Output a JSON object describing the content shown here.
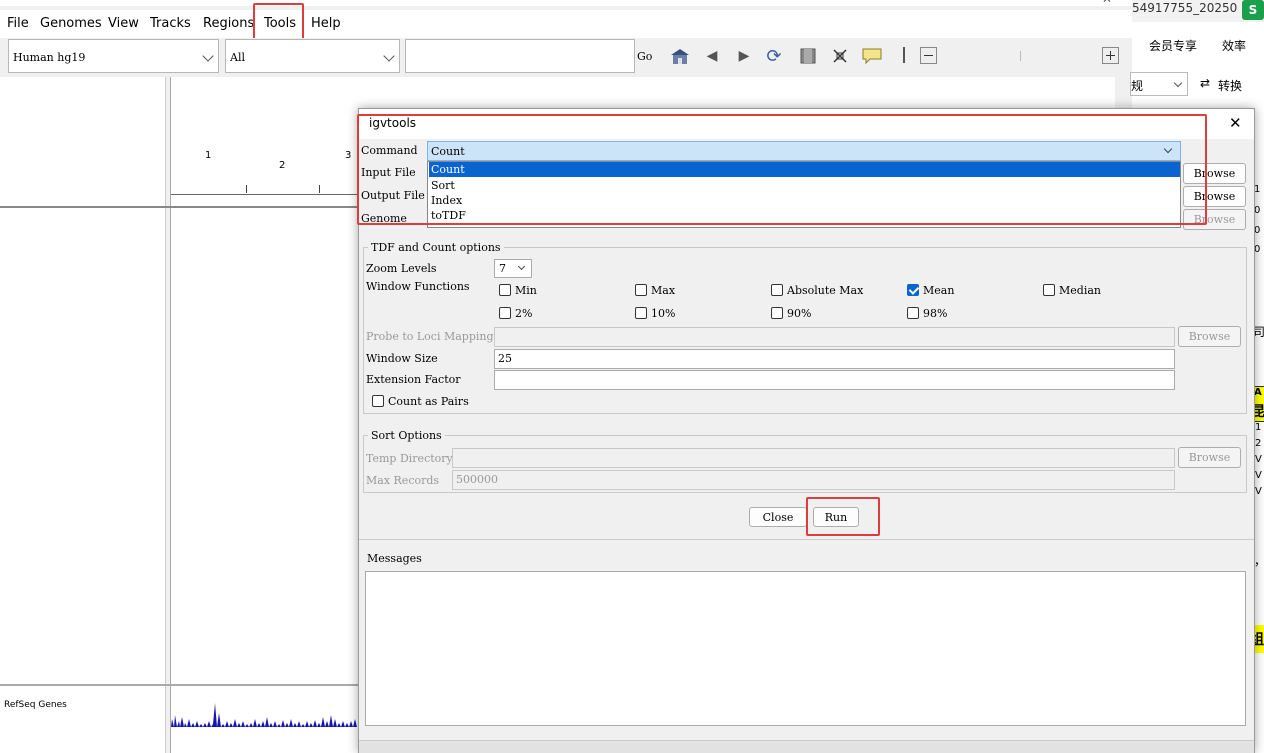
{
  "menubar": {
    "items": [
      "File",
      "Genomes",
      "View",
      "Tracks",
      "Regions",
      "Tools",
      "Help"
    ]
  },
  "toolbar": {
    "genome": "Human hg19",
    "chromosome": "All",
    "locus_value": "",
    "go_label": "Go",
    "icons": [
      "home-icon",
      "back-icon",
      "forward-icon",
      "refresh-icon",
      "roi-icon",
      "resize-icon",
      "popup-text-icon",
      "zoom-out-icon",
      "zoom-in-icon"
    ]
  },
  "ruler": {
    "labels": [
      "1",
      "2",
      "3"
    ]
  },
  "tracks": {
    "refseq": "RefSeq Genes"
  },
  "background_app": {
    "tab_title": "54917755_20250",
    "badge": "S",
    "members": "会员专享",
    "efficiency": "效率",
    "view_combo": "规",
    "convert": "转换",
    "fragments": [
      "1",
      "0",
      "0",
      "0",
      "司",
      "A",
      "昆",
      "1",
      "2",
      "V",
      "V",
      "V",
      "，",
      "组"
    ]
  },
  "dialog": {
    "title": "igvtools",
    "close_icon": "close-icon",
    "command_label": "Command",
    "command_value": "Count",
    "command_options": [
      "Count",
      "Sort",
      "Index",
      "toTDF"
    ],
    "input_file_label": "Input File",
    "output_file_label": "Output File",
    "genome_label": "Genome",
    "browse_label": "Browse",
    "tdf_group": {
      "title": "TDF and Count options",
      "zoom_label": "Zoom Levels",
      "zoom_value": "7",
      "window_functions_label": "Window Functions",
      "functions": [
        {
          "label": "Min",
          "checked": false
        },
        {
          "label": "Max",
          "checked": false
        },
        {
          "label": "Absolute Max",
          "checked": false
        },
        {
          "label": "Mean",
          "checked": true
        },
        {
          "label": "Median",
          "checked": false
        },
        {
          "label": "2%",
          "checked": false
        },
        {
          "label": "10%",
          "checked": false
        },
        {
          "label": "90%",
          "checked": false
        },
        {
          "label": "98%",
          "checked": false
        }
      ],
      "probe_label": "Probe to Loci Mapping",
      "window_size_label": "Window Size",
      "window_size_value": "25",
      "extension_label": "Extension Factor",
      "extension_value": "",
      "pairs_label": "Count as Pairs"
    },
    "sort_group": {
      "title": "Sort Options",
      "temp_dir_label": "Temp Directory",
      "max_records_label": "Max Records",
      "max_records_value": "500000"
    },
    "close_button": "Close",
    "run_button": "Run",
    "messages_label": "Messages",
    "messages_value": ""
  },
  "colors": {
    "highlight": "#e03c3c",
    "selection": "#0a64d0",
    "gene_bars": "#1515b5"
  }
}
